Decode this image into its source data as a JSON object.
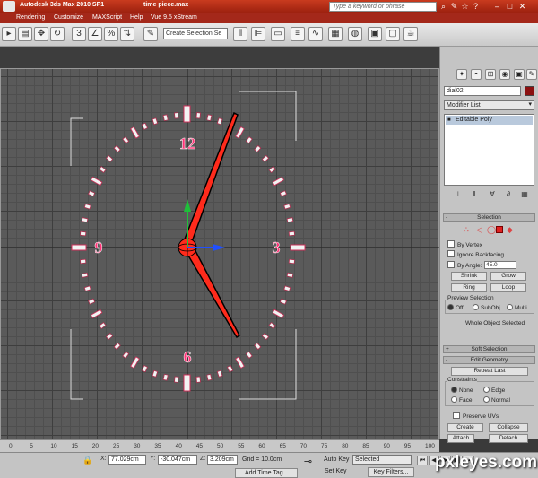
{
  "titlebar": {
    "app": "Autodesk 3ds Max  2010 SP1",
    "file": "time piece.max",
    "search_placeholder": "Type a keyword or phrase"
  },
  "menu": [
    "Rendering",
    "Customize",
    "MAXScript",
    "Help",
    "Vue 9.5 xStream"
  ],
  "toolbar": {
    "selection_set_placeholder": "Create Selection Se"
  },
  "clock": {
    "numerals": [
      "12",
      "3",
      "6",
      "9"
    ],
    "hand_color": "#ff2b1c",
    "numeral_color": "#ff3377"
  },
  "command_panel": {
    "object_name": "dial02",
    "modifier_list": "Modifier List",
    "stack_item": "Editable Poly",
    "selection_rollout": {
      "title": "Selection",
      "by_vertex": "By Vertex",
      "ignore_backfacing": "Ignore Backfacing",
      "by_angle": "By Angle:",
      "angle_value": "45.0",
      "shrink": "Shrink",
      "grow": "Grow",
      "ring": "Ring",
      "loop": "Loop",
      "preview_selection": "Preview Selection",
      "off": "Off",
      "subobj": "SubObj",
      "multi": "Multi",
      "status": "Whole Object Selected"
    },
    "soft_selection": "Soft Selection",
    "edit_geometry": {
      "title": "Edit Geometry",
      "repeat_last": "Repeat Last",
      "constraints": "Constraints",
      "none": "None",
      "edge": "Edge",
      "face": "Face",
      "normal": "Normal",
      "preserve_uvs": "Preserve UVs",
      "create": "Create",
      "collapse": "Collapse",
      "attach": "Attach",
      "detach": "Detach"
    }
  },
  "ruler": {
    "ticks": [
      "0",
      "5",
      "10",
      "15",
      "20",
      "25",
      "30",
      "35",
      "40",
      "45",
      "50",
      "55",
      "60",
      "65",
      "70",
      "75",
      "80",
      "85",
      "90",
      "95",
      "100"
    ]
  },
  "status": {
    "x_label": "X:",
    "x": "77.029cm",
    "y_label": "Y:",
    "y": "-30.047cm",
    "z_label": "Z:",
    "z": "3.209cm",
    "grid": "Grid = 10.0cm",
    "add_time_tag": "Add Time Tag",
    "auto_key": "Auto Key",
    "selected": "Selected",
    "set_key": "Set Key",
    "key_filters": "Key Filters..."
  },
  "watermark": "pxleyes.com"
}
